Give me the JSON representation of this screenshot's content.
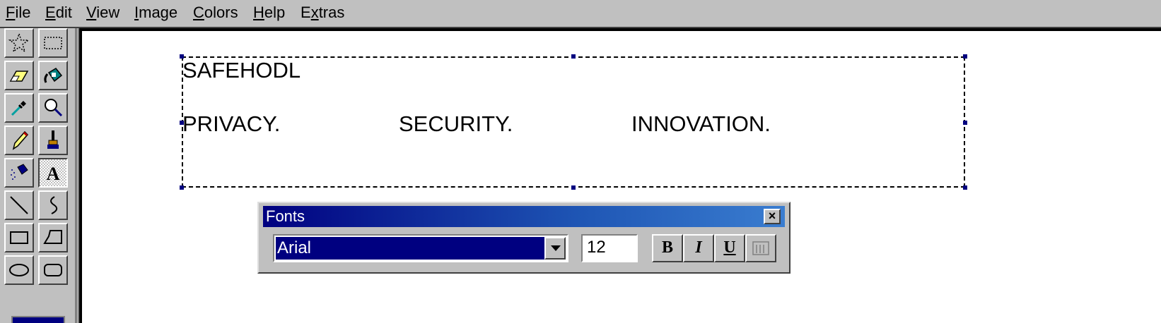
{
  "menu": [
    {
      "pre": "",
      "ul": "F",
      "post": "ile"
    },
    {
      "pre": "",
      "ul": "E",
      "post": "dit"
    },
    {
      "pre": "",
      "ul": "V",
      "post": "iew"
    },
    {
      "pre": "",
      "ul": "I",
      "post": "mage"
    },
    {
      "pre": "",
      "ul": "C",
      "post": "olors"
    },
    {
      "pre": "",
      "ul": "H",
      "post": "elp"
    },
    {
      "pre": "E",
      "ul": "x",
      "post": "tras"
    }
  ],
  "tools": [
    {
      "name": "free-form-select",
      "icon": "star-select-icon"
    },
    {
      "name": "rect-select",
      "icon": "rect-select-icon"
    },
    {
      "name": "eraser",
      "icon": "eraser-icon"
    },
    {
      "name": "fill",
      "icon": "fill-bucket-icon"
    },
    {
      "name": "pick-color",
      "icon": "eyedropper-icon"
    },
    {
      "name": "magnifier",
      "icon": "magnifier-icon"
    },
    {
      "name": "pencil",
      "icon": "pencil-icon"
    },
    {
      "name": "brush",
      "icon": "brush-icon"
    },
    {
      "name": "airbrush",
      "icon": "airbrush-icon"
    },
    {
      "name": "text",
      "icon": "text-icon",
      "active": true
    },
    {
      "name": "line",
      "icon": "line-icon"
    },
    {
      "name": "curve",
      "icon": "curve-icon"
    },
    {
      "name": "rectangle",
      "icon": "rectangle-icon"
    },
    {
      "name": "polygon",
      "icon": "polygon-icon"
    },
    {
      "name": "ellipse",
      "icon": "ellipse-icon"
    },
    {
      "name": "rounded-rectangle",
      "icon": "rounded-rect-icon"
    }
  ],
  "canvas": {
    "line1": "SAFEHODL",
    "word1": "PRIVACY.",
    "word2": "SECURITY.",
    "word3": "INNOVATION."
  },
  "fonts_toolbar": {
    "title": "Fonts",
    "close_label": "×",
    "font_name": "Arial",
    "font_size": "12",
    "bold_label": "B",
    "italic_label": "I",
    "underline_label": "U"
  },
  "colors": {
    "primary": "#000080",
    "background": "#c0c0c0"
  }
}
